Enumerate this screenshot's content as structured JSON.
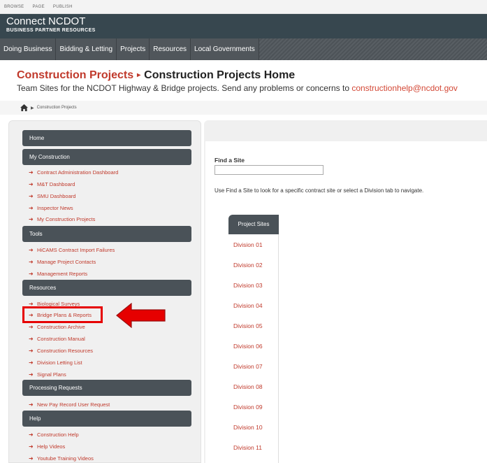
{
  "ribbon": {
    "tabs": [
      "BROWSE",
      "PAGE",
      "PUBLISH"
    ]
  },
  "brand": {
    "title": "Connect NCDOT",
    "subtitle": "BUSINESS PARTNER RESOURCES"
  },
  "nav": {
    "items": [
      "Doing Business",
      "Bidding & Letting",
      "Projects",
      "Resources",
      "Local Governments"
    ]
  },
  "page": {
    "crumb": "Construction Projects",
    "title": "Construction Projects Home",
    "subtitle_text": "Team Sites for the NCDOT Highway & Bridge projects.  Send any problems or concerns to ",
    "subtitle_email": "constructionhelp@ncdot.gov"
  },
  "breadcrumb": {
    "text": "Construction Projects"
  },
  "sidebar": {
    "home": "Home",
    "my_construction": {
      "header": "My Construction",
      "links": [
        "Contract Administration Dashboard",
        "M&T Dashboard",
        "SMU Dashboard",
        "Inspector News",
        "My Construction Projects"
      ]
    },
    "tools": {
      "header": "Tools",
      "links": [
        "HiCAMS Contract Import Failures",
        "Manage Project Contacts",
        "Management Reports"
      ]
    },
    "resources": {
      "header": "Resources",
      "links": [
        "Biological Surveys",
        "Bridge Plans & Reports",
        "Construction Archive",
        "Construction Manual",
        "Construction Resources",
        "Division Letting List",
        "Signal Plans"
      ]
    },
    "processing": {
      "header": "Processing Requests",
      "links": [
        "New Pay Record User Request"
      ]
    },
    "help": {
      "header": "Help",
      "links": [
        "Construction Help",
        "Help Videos",
        "Youtube Training Videos"
      ]
    }
  },
  "find_site": {
    "label": "Find a Site",
    "value": "",
    "help": "Use Find a Site to look for a specific contract site or select a Division tab to navigate."
  },
  "divisions": {
    "active_tab": "Project Sites",
    "tabs": [
      "Division 01",
      "Division 02",
      "Division 03",
      "Division 04",
      "Division 05",
      "Division 06",
      "Division 07",
      "Division 08",
      "Division 09",
      "Division 10",
      "Division 11"
    ]
  },
  "colors": {
    "link_red": "#c0392b",
    "header_dark": "#37474f",
    "annotation_red": "#e60000"
  }
}
